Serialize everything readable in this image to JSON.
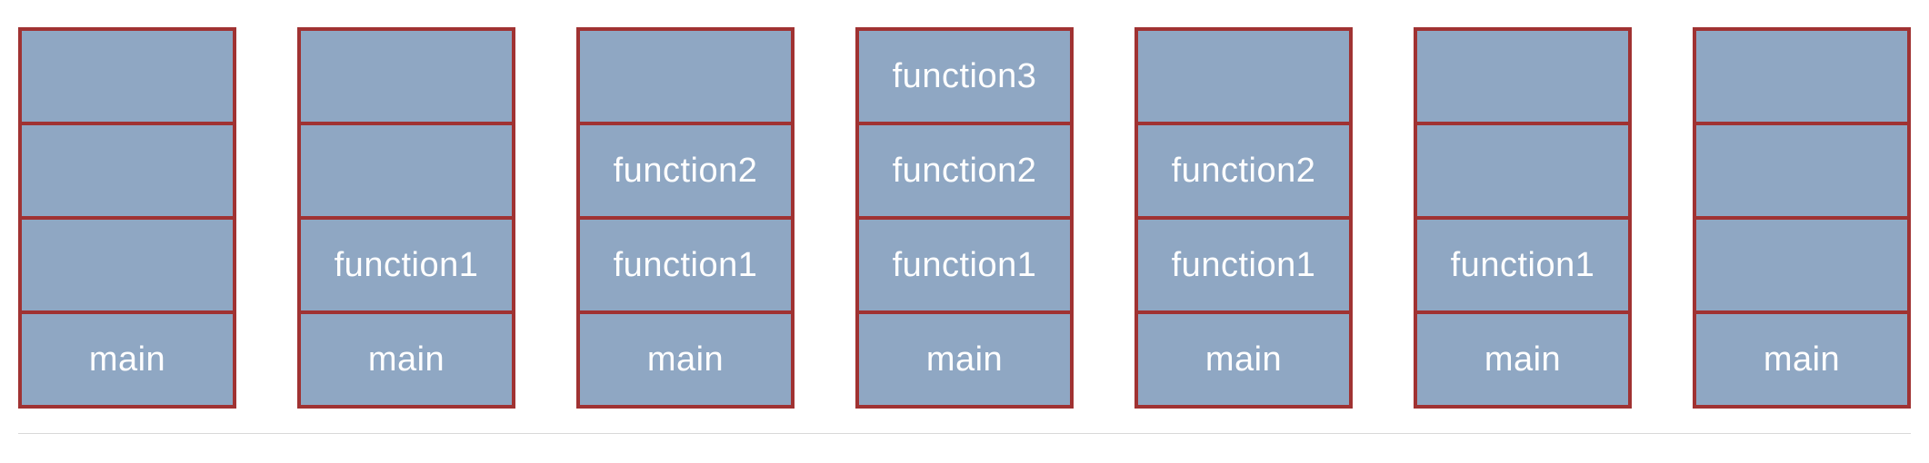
{
  "colors": {
    "frame_fill": "#8fa7c3",
    "frame_border": "#a03232",
    "label_text": "#ffffff",
    "background": "#ffffff"
  },
  "stacks": [
    {
      "frames": [
        "",
        "",
        "",
        "main"
      ]
    },
    {
      "frames": [
        "",
        "",
        "function1",
        "main"
      ]
    },
    {
      "frames": [
        "",
        "function2",
        "function1",
        "main"
      ]
    },
    {
      "frames": [
        "function3",
        "function2",
        "function1",
        "main"
      ]
    },
    {
      "frames": [
        "",
        "function2",
        "function1",
        "main"
      ]
    },
    {
      "frames": [
        "",
        "",
        "function1",
        "main"
      ]
    },
    {
      "frames": [
        "",
        "",
        "",
        "main"
      ]
    }
  ]
}
